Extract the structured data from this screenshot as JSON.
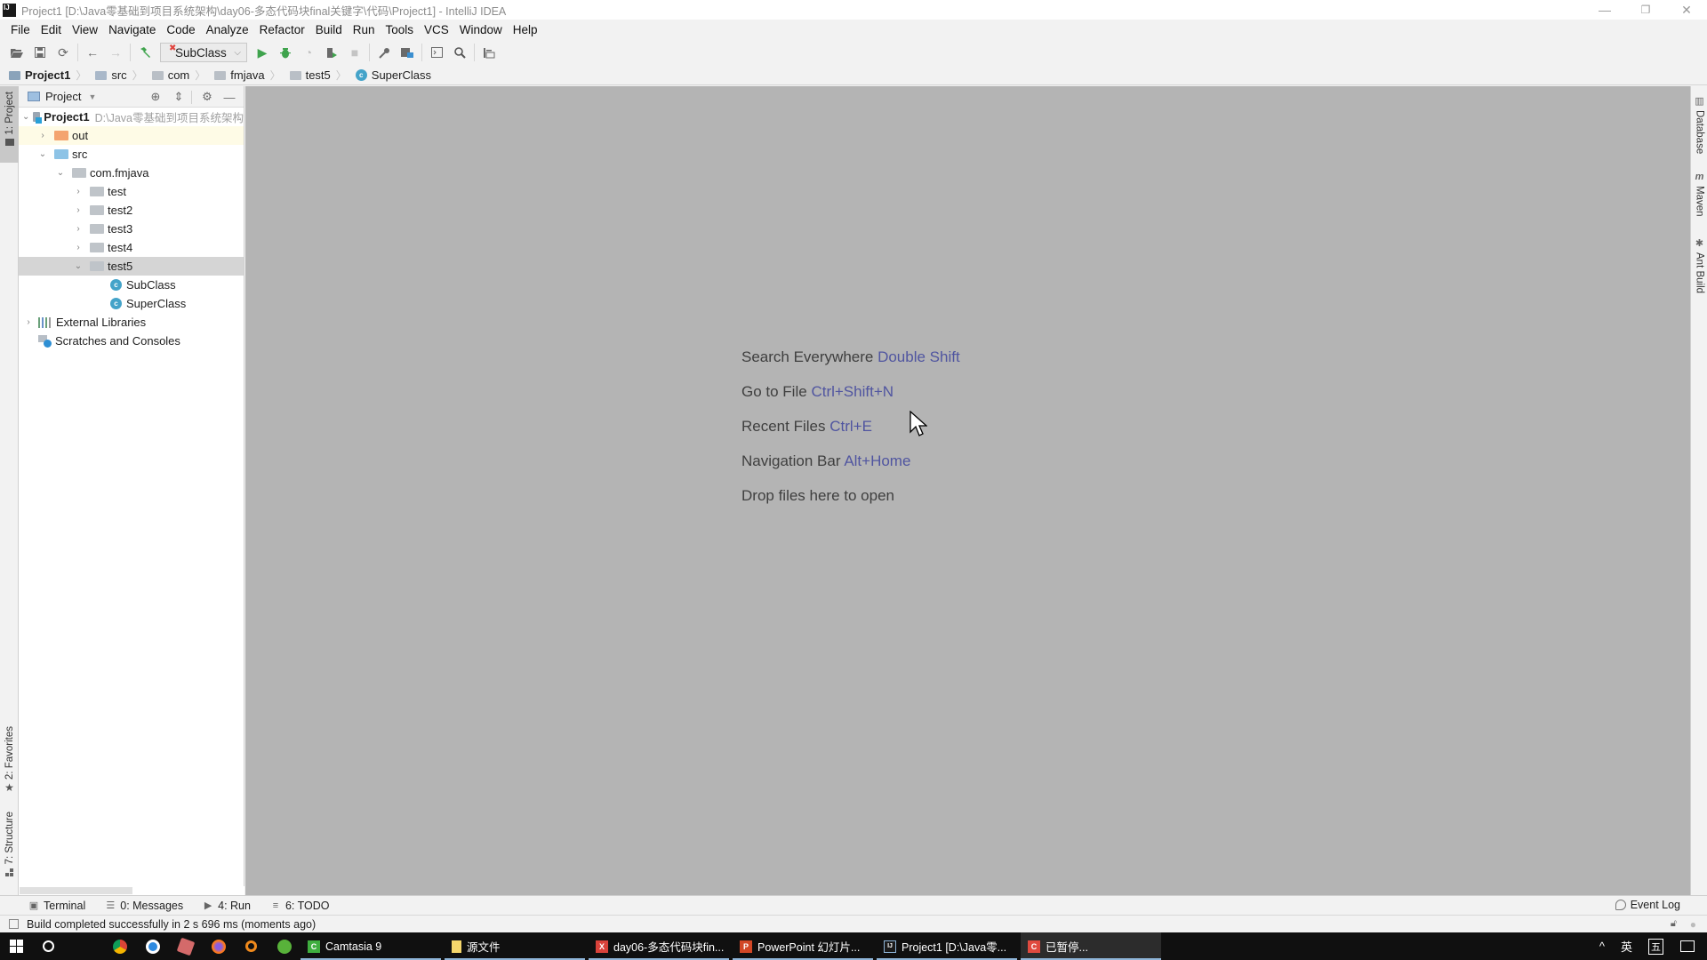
{
  "window": {
    "app_icon": "IJ",
    "title": "Project1 [D:\\Java零基础到项目系统架构\\day06-多态代码块final关键字\\代码\\Project1] - IntelliJ IDEA",
    "controls": {
      "minimize": "—",
      "restore": "❐",
      "close": "✕"
    }
  },
  "menu": [
    "File",
    "Edit",
    "View",
    "Navigate",
    "Code",
    "Analyze",
    "Refactor",
    "Build",
    "Run",
    "Tools",
    "VCS",
    "Window",
    "Help"
  ],
  "toolbar": {
    "icons": [
      "open-folder-icon",
      "save-icon",
      "sync-icon",
      "back-icon",
      "forward-icon",
      "build-hammer-icon",
      "run-icon",
      "debug-icon",
      "coverage-icon",
      "profile-icon",
      "stop-icon",
      "settings-wrench-icon",
      "project-structure-icon",
      "terminal-frame-icon",
      "search-icon",
      "vcs-icon"
    ],
    "run_config": "SubClass"
  },
  "breadcrumb": [
    "Project1",
    "src",
    "com",
    "fmjava",
    "test5",
    "SuperClass"
  ],
  "left_strip": {
    "project_tab": "1: Project",
    "favorites_tab": "2: Favorites",
    "structure_tab": "7: Structure"
  },
  "right_strip": {
    "database_tab": "Database",
    "maven_tab": "Maven",
    "ant_tab": "Ant Build"
  },
  "project_panel": {
    "header": "Project",
    "tree": [
      {
        "label": "Project1",
        "path": "D:\\Java零基础到项目系统架构",
        "kind": "project",
        "depth": 0,
        "state": "expanded"
      },
      {
        "label": "out",
        "kind": "folder-orange",
        "depth": 1,
        "state": "collapsed"
      },
      {
        "label": "src",
        "kind": "folder-blue",
        "depth": 1,
        "state": "expanded"
      },
      {
        "label": "com.fmjava",
        "kind": "package",
        "depth": 2,
        "state": "expanded"
      },
      {
        "label": "test",
        "kind": "package",
        "depth": 3,
        "state": "collapsed"
      },
      {
        "label": "test2",
        "kind": "package",
        "depth": 3,
        "state": "collapsed"
      },
      {
        "label": "test3",
        "kind": "package",
        "depth": 3,
        "state": "collapsed"
      },
      {
        "label": "test4",
        "kind": "package",
        "depth": 3,
        "state": "collapsed"
      },
      {
        "label": "test5",
        "kind": "package",
        "depth": 3,
        "state": "expanded",
        "selected": true
      },
      {
        "label": "SubClass",
        "kind": "class",
        "depth": 4
      },
      {
        "label": "SuperClass",
        "kind": "class",
        "depth": 4
      },
      {
        "label": "External Libraries",
        "kind": "libraries",
        "depth": 0,
        "state": "collapsed"
      },
      {
        "label": "Scratches and Consoles",
        "kind": "scratches",
        "depth": 0
      }
    ]
  },
  "editor_hints": [
    {
      "text": "Search Everywhere",
      "shortcut": "Double Shift"
    },
    {
      "text": "Go to File",
      "shortcut": "Ctrl+Shift+N"
    },
    {
      "text": "Recent Files",
      "shortcut": "Ctrl+E"
    },
    {
      "text": "Navigation Bar",
      "shortcut": "Alt+Home"
    },
    {
      "text": "Drop files here to open",
      "shortcut": ""
    }
  ],
  "bottom_tabs": [
    "Terminal",
    "0: Messages",
    "4: Run",
    "6: TODO"
  ],
  "event_log": "Event Log",
  "status": "Build completed successfully in 2 s 696 ms (moments ago)",
  "taskbar": {
    "tasks": [
      {
        "label": "Camtasia 9",
        "icon": "C",
        "color": "#3fae3f"
      },
      {
        "label": "源文件",
        "icon": "",
        "color": "#f5d66b"
      },
      {
        "label": "day06-多态代码块fin...",
        "icon": "X",
        "color": "#d9423a"
      },
      {
        "label": "PowerPoint 幻灯片...",
        "icon": "P",
        "color": "#d24726"
      },
      {
        "label": "Project1 [D:\\Java零...",
        "icon": "IJ",
        "color": "#1b1b1b"
      },
      {
        "label": "已暂停...",
        "icon": "C",
        "color": "#e04a3f"
      }
    ],
    "tray": {
      "chevron": "^",
      "ime": "英",
      "wubi": "五"
    }
  },
  "colors": {
    "editor_bg": "#b4b4b4",
    "shortcut": "#5055a0",
    "selection": "#d5d5d5",
    "project_row_highlight": "#fefbe6"
  }
}
